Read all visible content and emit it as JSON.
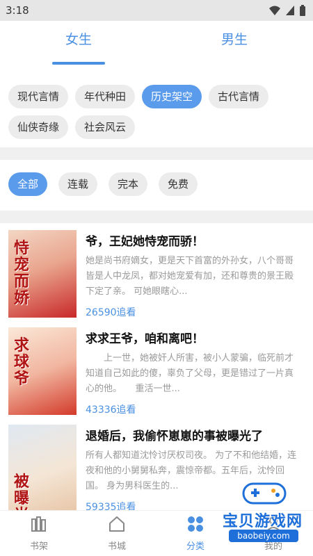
{
  "status_bar": {
    "time": "3:18"
  },
  "gender_tabs": {
    "female": "女生",
    "male": "男生"
  },
  "genre_chips": [
    "现代言情",
    "年代种田",
    "历史架空",
    "古代言情",
    "仙侠奇缘",
    "社会风云"
  ],
  "genre_selected": "历史架空",
  "status_chips": [
    "全部",
    "连载",
    "完本",
    "免费"
  ],
  "status_selected": "全部",
  "books": [
    {
      "title": "爷，王妃她恃宠而骄！",
      "cover_text": "恃宠而娇",
      "description": "她是尚书府嫡女，更是天下首富的外孙女，八个哥哥皆是人中龙凤，都对她宠爱有加，还和尊贵的景王殿下定了亲。 可她眼瞎心...",
      "readers": "26590追看",
      "cover_colors": [
        "#f3d6c4",
        "#c82828"
      ]
    },
    {
      "title": "求求王爷，咱和离吧！",
      "cover_text": "求球爷",
      "description": "　　上一世，她被奸人所害，被小人蒙骗，临死前才知道自己如此的傻，辜负了父母，更是错过了一片真心的他。　　重活一世...",
      "readers": "43336追看",
      "cover_colors": [
        "#fbe8d8",
        "#d33a2a"
      ]
    },
    {
      "title": "退婚后，我偷怀崽崽的事被曝光了",
      "cover_text": "被曝光",
      "description": "所有人都知道沈怜讨厌权司夜。 为了不和他结婚，连夜和他的小舅舅私奔，震惊帝都。五年后，沈怜回国。 身为男科医生的...",
      "readers": "59335追看",
      "cover_colors": [
        "#dfe8f2",
        "#e8c6a8"
      ]
    }
  ],
  "bottom_nav": {
    "shelf": "书架",
    "store": "书城",
    "category": "分类",
    "mine": "我的"
  },
  "watermark": {
    "text": "宝贝游戏网",
    "url": "baobeiy.com"
  },
  "colors": {
    "accent": "#4a90e2",
    "chip_bg": "#ececec",
    "chip_active": "#5b9bec"
  }
}
